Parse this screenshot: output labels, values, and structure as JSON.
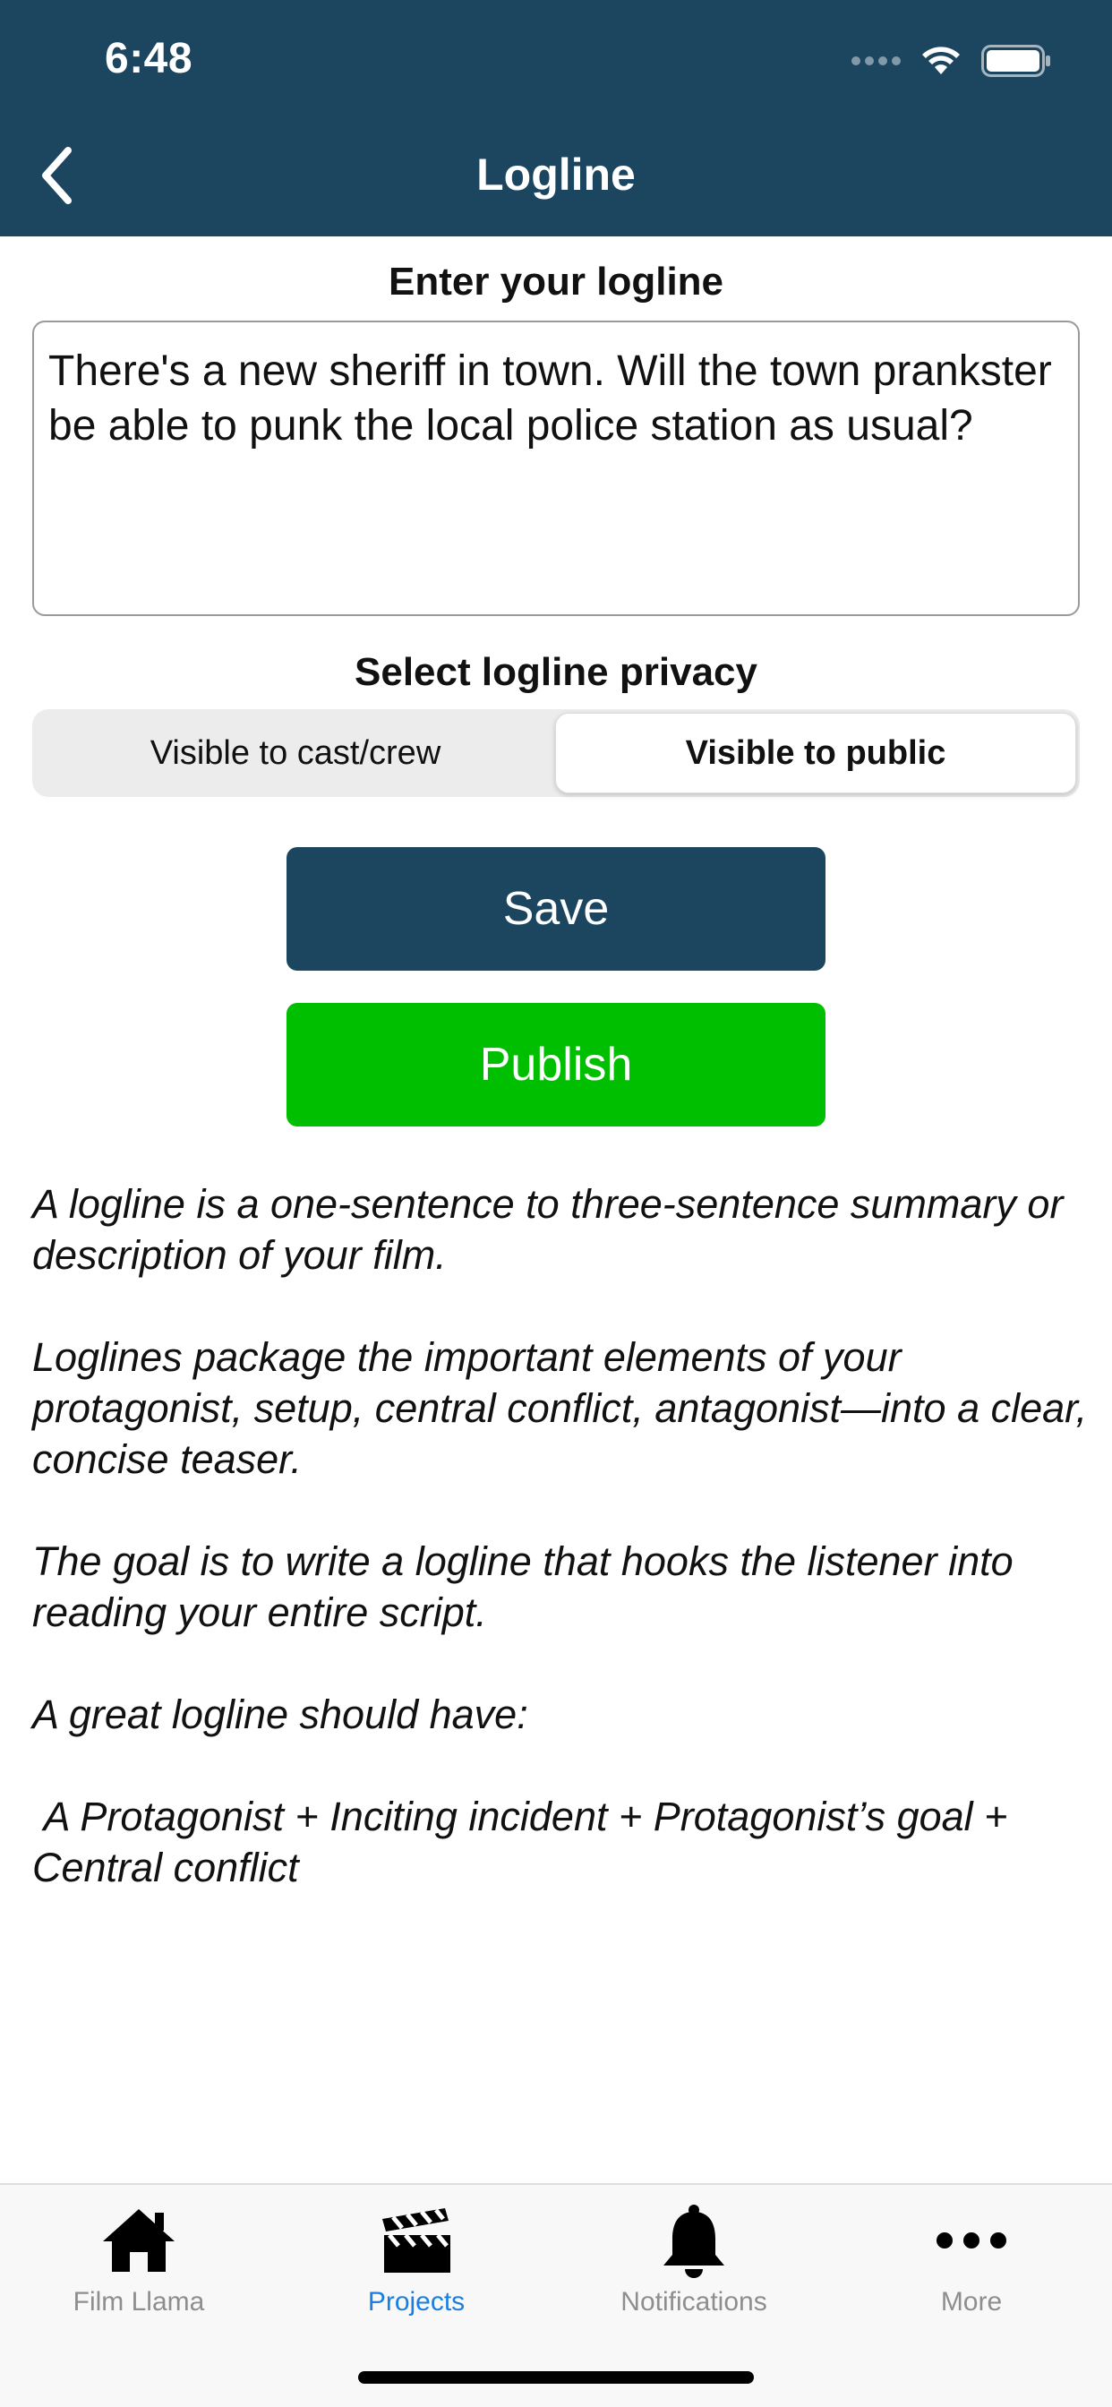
{
  "status_bar": {
    "time": "6:48"
  },
  "nav": {
    "title": "Logline",
    "back_icon": "chevron-left-icon"
  },
  "logline": {
    "label": "Enter your logline",
    "value": "There's a new sheriff in town. Will the town prankster be able to punk the local police station as usual?"
  },
  "privacy": {
    "label": "Select logline privacy",
    "options": [
      "Visible to cast/crew",
      "Visible to public"
    ],
    "selected": "Visible to public"
  },
  "actions": {
    "save_label": "Save",
    "publish_label": "Publish"
  },
  "help": {
    "paragraphs": [
      "A logline is a one-sentence to three-sentence summary or description of your film.",
      "Loglines package the important elements of your protagonist, setup, central conflict, antagonist—into a clear, concise teaser.",
      "The goal is to write a logline that hooks the listener into reading your entire script.",
      "A great logline should have:",
      " A Protagonist + Inciting incident + Protagonist’s goal + Central conflict"
    ]
  },
  "tabbar": {
    "tabs": [
      {
        "label": "Film Llama",
        "icon": "home-icon"
      },
      {
        "label": "Projects",
        "icon": "clapperboard-icon",
        "active": true
      },
      {
        "label": "Notifications",
        "icon": "bell-icon"
      },
      {
        "label": "More",
        "icon": "more-icon"
      }
    ]
  },
  "colors": {
    "header": "#1c4660",
    "save": "#1c4660",
    "publish": "#00bf00",
    "active_tab": "#1a7fe0"
  }
}
